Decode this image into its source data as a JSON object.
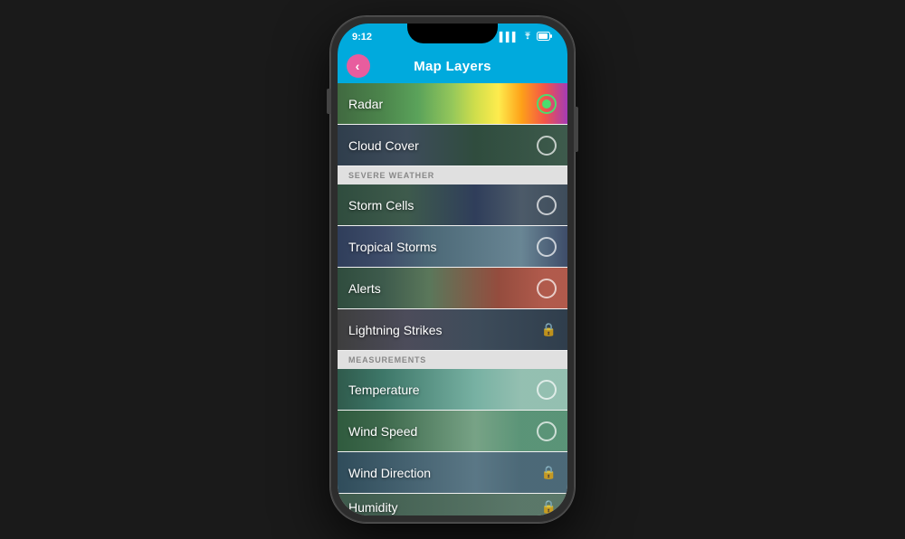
{
  "phone": {
    "status_bar": {
      "time": "9:12",
      "signal": "▌▌▌",
      "wifi": "WiFi",
      "battery": "Battery"
    },
    "header": {
      "title": "Map Layers",
      "back_label": "‹"
    },
    "sections": {
      "severe_weather_label": "SEVERE WEATHER",
      "measurements_label": "MEASUREMENTS"
    },
    "layers": [
      {
        "id": "radar",
        "label": "Radar",
        "control": "radio-active",
        "bg_class": "radar-bg"
      },
      {
        "id": "cloud-cover",
        "label": "Cloud Cover",
        "control": "radio",
        "bg_class": "cloud-bg"
      },
      {
        "id": "storm-cells",
        "label": "Storm Cells",
        "control": "radio",
        "bg_class": "storm-cells-bg"
      },
      {
        "id": "tropical-storms",
        "label": "Tropical Storms",
        "control": "radio",
        "bg_class": "tropical-bg"
      },
      {
        "id": "alerts",
        "label": "Alerts",
        "control": "radio",
        "bg_class": "alerts-bg"
      },
      {
        "id": "lightning-strikes",
        "label": "Lightning Strikes",
        "control": "lock",
        "bg_class": "lightning-bg"
      },
      {
        "id": "temperature",
        "label": "Temperature",
        "control": "radio",
        "bg_class": "temperature-bg"
      },
      {
        "id": "wind-speed",
        "label": "Wind Speed",
        "control": "radio",
        "bg_class": "windspeed-bg"
      },
      {
        "id": "wind-direction",
        "label": "Wind Direction",
        "control": "lock",
        "bg_class": "winddir-bg"
      },
      {
        "id": "humidity",
        "label": "Humidity",
        "control": "lock",
        "bg_class": "humidity-bg"
      }
    ]
  }
}
